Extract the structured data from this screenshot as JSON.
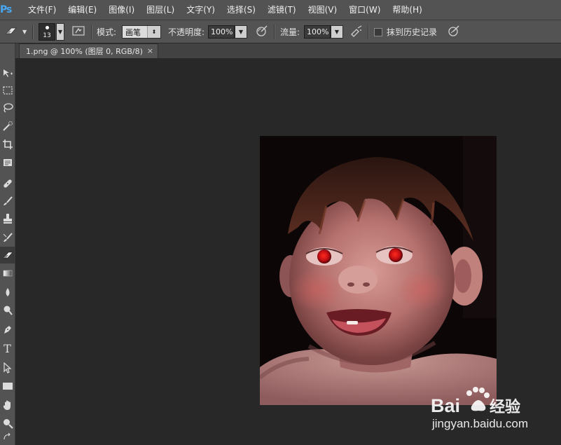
{
  "app": {
    "logo": "Ps"
  },
  "menu": [
    "文件(F)",
    "编辑(E)",
    "图像(I)",
    "图层(L)",
    "文字(Y)",
    "选择(S)",
    "滤镜(T)",
    "视图(V)",
    "窗口(W)",
    "帮助(H)"
  ],
  "options": {
    "brush_size": "13",
    "mode_label": "模式:",
    "mode_value": "画笔",
    "opacity_label": "不透明度:",
    "opacity_value": "100%",
    "flow_label": "流量:",
    "flow_value": "100%",
    "erase_history_label": "抹到历史记录",
    "erase_history_checked": false
  },
  "tools": [
    "move-tool-icon",
    "marquee-tool-icon",
    "lasso-tool-icon",
    "quick-selection-tool-icon",
    "crop-tool-icon",
    "eyedropper-tool-icon",
    "healing-brush-tool-icon",
    "brush-tool-icon",
    "clone-stamp-tool-icon",
    "history-brush-tool-icon",
    "eraser-tool-icon",
    "gradient-tool-icon",
    "blur-tool-icon",
    "dodge-tool-icon",
    "pen-tool-icon",
    "type-tool-icon",
    "path-selection-tool-icon",
    "rectangle-tool-icon",
    "hand-tool-icon",
    "zoom-tool-icon"
  ],
  "active_tool": "eraser-tool-icon",
  "document": {
    "tab_title": "1.png @ 100% (图层 0, RGB/8)",
    "close_symbol": "×"
  },
  "watermark": {
    "brand_text": "Bai",
    "brand_text2": "经验",
    "url": "jingyan.baidu.com"
  },
  "colors": {
    "ui_panel": "#535353",
    "canvas_bg": "#282828",
    "logo_blue": "#47a8f5",
    "red_eye": "#d4141a"
  }
}
